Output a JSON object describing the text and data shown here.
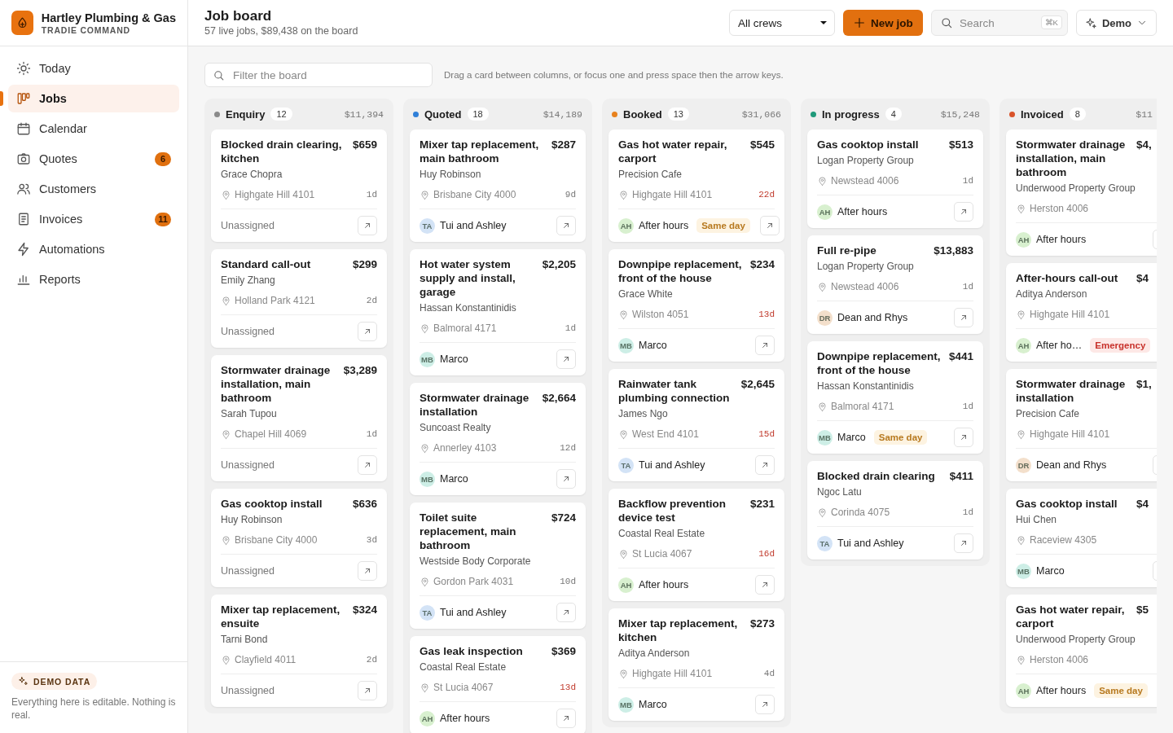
{
  "brand": {
    "name": "Hartley Plumbing & Gas",
    "tagline": "TRADIE COMMAND"
  },
  "sidebar": {
    "items": [
      {
        "label": "Today",
        "selected": false
      },
      {
        "label": "Jobs",
        "selected": true
      },
      {
        "label": "Calendar",
        "selected": false
      },
      {
        "label": "Quotes",
        "selected": false,
        "badge": "6"
      },
      {
        "label": "Customers",
        "selected": false
      },
      {
        "label": "Invoices",
        "selected": false,
        "badge": "11"
      },
      {
        "label": "Automations",
        "selected": false
      },
      {
        "label": "Reports",
        "selected": false
      }
    ],
    "footer": {
      "badge": "DEMO DATA",
      "text": "Everything here is editable. Nothing is real."
    }
  },
  "header": {
    "title": "Job board",
    "subtitle": "57 live jobs, $89,438 on the board",
    "crew_select": "All crews",
    "new_button": "New job",
    "search": {
      "placeholder": "Search",
      "shortcut": "⌘K"
    },
    "demo_button": "Demo"
  },
  "filter": {
    "placeholder": "Filter the board",
    "hint": "Drag a card between columns, or focus one and press space then the arrow keys."
  },
  "columns": [
    {
      "name": "Enquiry",
      "count": "12",
      "total": "$11,394",
      "color": "#8a8a8a",
      "cards": [
        {
          "title": "Blocked drain clearing, kitchen",
          "price": "$659",
          "customer": "Grace Chopra",
          "location": "Highgate Hill 4101",
          "age": "1d",
          "overdue": false,
          "assignee": {
            "name": "Unassigned"
          }
        },
        {
          "title": "Standard call-out",
          "price": "$299",
          "customer": "Emily Zhang",
          "location": "Holland Park 4121",
          "age": "2d",
          "overdue": false,
          "assignee": {
            "name": "Unassigned"
          }
        },
        {
          "title": "Stormwater drainage installation, main bathroom",
          "price": "$3,289",
          "customer": "Sarah Tupou",
          "location": "Chapel Hill 4069",
          "age": "1d",
          "overdue": false,
          "assignee": {
            "name": "Unassigned"
          }
        },
        {
          "title": "Gas cooktop install",
          "price": "$636",
          "customer": "Huy Robinson",
          "location": "Brisbane City 4000",
          "age": "3d",
          "overdue": false,
          "assignee": {
            "name": "Unassigned"
          }
        },
        {
          "title": "Mixer tap replacement, ensuite",
          "price": "$324",
          "customer": "Tarni Bond",
          "location": "Clayfield 4011",
          "age": "2d",
          "overdue": false,
          "assignee": {
            "name": "Unassigned"
          }
        }
      ]
    },
    {
      "name": "Quoted",
      "count": "18",
      "total": "$14,189",
      "color": "#2f7fd8",
      "cards": [
        {
          "title": "Mixer tap replacement, main bathroom",
          "price": "$287",
          "customer": "Huy Robinson",
          "location": "Brisbane City 4000",
          "age": "9d",
          "overdue": false,
          "assignee": {
            "initials": "TA",
            "name": "Tui and Ashley",
            "color": "#d3e3f6"
          }
        },
        {
          "title": "Hot water system supply and install, garage",
          "price": "$2,205",
          "customer": "Hassan Konstantinidis",
          "location": "Balmoral 4171",
          "age": "1d",
          "overdue": false,
          "assignee": {
            "initials": "MB",
            "name": "Marco",
            "color": "#cdeee6"
          }
        },
        {
          "title": "Stormwater drainage installation",
          "price": "$2,664",
          "customer": "Suncoast Realty",
          "location": "Annerley 4103",
          "age": "12d",
          "overdue": false,
          "assignee": {
            "initials": "MB",
            "name": "Marco",
            "color": "#cdeee6"
          }
        },
        {
          "title": "Toilet suite replacement, main bathroom",
          "price": "$724",
          "customer": "Westside Body Corporate",
          "location": "Gordon Park 4031",
          "age": "10d",
          "overdue": false,
          "assignee": {
            "initials": "TA",
            "name": "Tui and Ashley",
            "color": "#d3e3f6"
          }
        },
        {
          "title": "Gas leak inspection",
          "price": "$369",
          "customer": "Coastal Real Estate",
          "location": "St Lucia 4067",
          "age": "13d",
          "overdue": true,
          "assignee": {
            "initials": "AH",
            "name": "After hours",
            "color": "#d8f0cf"
          }
        }
      ]
    },
    {
      "name": "Booked",
      "count": "13",
      "total": "$31,066",
      "color": "#e8821e",
      "cards": [
        {
          "title": "Gas hot water repair, carport",
          "price": "$545",
          "customer": "Precision Cafe",
          "location": "Highgate Hill 4101",
          "age": "22d",
          "overdue": true,
          "assignee": {
            "initials": "AH",
            "name": "After hours",
            "color": "#d8f0cf"
          },
          "tag": {
            "label": "Same day",
            "kind": "same_day"
          }
        },
        {
          "title": "Downpipe replacement, front of the house",
          "price": "$234",
          "customer": "Grace White",
          "location": "Wilston 4051",
          "age": "13d",
          "overdue": true,
          "assignee": {
            "initials": "MB",
            "name": "Marco",
            "color": "#cdeee6"
          }
        },
        {
          "title": "Rainwater tank plumbing connection",
          "price": "$2,645",
          "customer": "James Ngo",
          "location": "West End 4101",
          "age": "15d",
          "overdue": true,
          "assignee": {
            "initials": "TA",
            "name": "Tui and Ashley",
            "color": "#d3e3f6"
          }
        },
        {
          "title": "Backflow prevention device test",
          "price": "$231",
          "customer": "Coastal Real Estate",
          "location": "St Lucia 4067",
          "age": "16d",
          "overdue": true,
          "assignee": {
            "initials": "AH",
            "name": "After hours",
            "color": "#d8f0cf"
          }
        },
        {
          "title": "Mixer tap replacement, kitchen",
          "price": "$273",
          "customer": "Aditya Anderson",
          "location": "Highgate Hill 4101",
          "age": "4d",
          "overdue": false,
          "assignee": {
            "initials": "MB",
            "name": "Marco",
            "color": "#cdeee6"
          }
        }
      ]
    },
    {
      "name": "In progress",
      "count": "4",
      "total": "$15,248",
      "color": "#1f9a7a",
      "cards": [
        {
          "title": "Gas cooktop install",
          "price": "$513",
          "customer": "Logan Property Group",
          "location": "Newstead 4006",
          "age": "1d",
          "overdue": false,
          "assignee": {
            "initials": "AH",
            "name": "After hours",
            "color": "#d8f0cf"
          }
        },
        {
          "title": "Full re-pipe",
          "price": "$13,883",
          "customer": "Logan Property Group",
          "location": "Newstead 4006",
          "age": "1d",
          "overdue": false,
          "assignee": {
            "initials": "DR",
            "name": "Dean and Rhys",
            "color": "#f3dfcb"
          }
        },
        {
          "title": "Downpipe replacement, front of the house",
          "price": "$441",
          "customer": "Hassan Konstantinidis",
          "location": "Balmoral 4171",
          "age": "1d",
          "overdue": false,
          "assignee": {
            "initials": "MB",
            "name": "Marco",
            "color": "#cdeee6"
          },
          "tag": {
            "label": "Same day",
            "kind": "same_day"
          }
        },
        {
          "title": "Blocked drain clearing",
          "price": "$411",
          "customer": "Ngoc Latu",
          "location": "Corinda 4075",
          "age": "1d",
          "overdue": false,
          "assignee": {
            "initials": "TA",
            "name": "Tui and Ashley",
            "color": "#d3e3f6"
          }
        }
      ]
    },
    {
      "name": "Invoiced",
      "count": "8",
      "total": "$11",
      "color": "#d9532a",
      "cards": [
        {
          "title": "Stormwater drainage installation, main bathroom",
          "price": "$4,",
          "customer": "Underwood Property Group",
          "location": "Herston 4006",
          "assignee": {
            "initials": "AH",
            "name": "After hours",
            "color": "#d8f0cf"
          }
        },
        {
          "title": "After-hours call-out",
          "price": "$4",
          "customer": "Aditya Anderson",
          "location": "Highgate Hill 4101",
          "assignee": {
            "initials": "AH",
            "name": "After ho…",
            "color": "#d8f0cf"
          },
          "tag": {
            "label": "Emergency",
            "kind": "emergency"
          }
        },
        {
          "title": "Stormwater drainage installation",
          "price": "$1,",
          "customer": "Precision Cafe",
          "location": "Highgate Hill 4101",
          "assignee": {
            "initials": "DR",
            "name": "Dean and Rhys",
            "color": "#f3dfcb"
          }
        },
        {
          "title": "Gas cooktop install",
          "price": "$4",
          "customer": "Hui Chen",
          "location": "Raceview 4305",
          "assignee": {
            "initials": "MB",
            "name": "Marco",
            "color": "#cdeee6"
          }
        },
        {
          "title": "Gas hot water repair, carport",
          "price": "$5",
          "customer": "Underwood Property Group",
          "location": "Herston 4006",
          "assignee": {
            "initials": "AH",
            "name": "After hours",
            "color": "#d8f0cf"
          },
          "tag": {
            "label": "Same day",
            "kind": "same_day"
          }
        }
      ]
    }
  ]
}
